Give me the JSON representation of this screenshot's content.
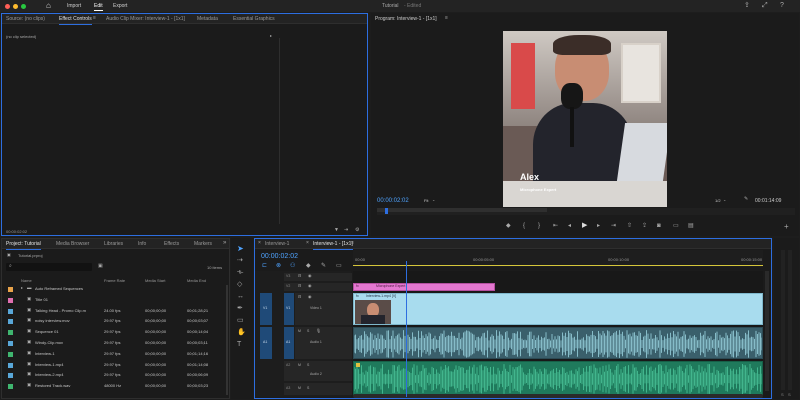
{
  "app": {
    "menu": [
      "Import",
      "Edit",
      "Export"
    ],
    "title": "Tutorial",
    "subtitle": "- Edited"
  },
  "effect_panel": {
    "tabs": [
      "Source: (no clips)",
      "Effect Controls",
      "Audio Clip Mixer: Interview-1 - [1x1]",
      "Metadata",
      "Essential Graphics"
    ],
    "active_tab": "Effect Controls",
    "no_clip": "(no clip selected)",
    "timecode": "00:00:02:02"
  },
  "program": {
    "title": "Program: Interview-1 - [1x1]",
    "caption_name": "Alex",
    "caption_sub": "Microphone Expert",
    "timecode": "00:00:02:02",
    "fit": "Fit",
    "fraction": "1/2",
    "duration": "00:01:14:09",
    "playhead_fraction": 0.02
  },
  "project": {
    "tabs": [
      "Project: Tutorial",
      "Media Browser",
      "Libraries",
      "Info",
      "Effects",
      "Markers"
    ],
    "file": "Tutorial.prproj",
    "items_count": "10 items",
    "columns": [
      "Name",
      "Frame Rate",
      "Media Start",
      "Media End"
    ],
    "rows": [
      {
        "name": "Auto Reframed Sequences",
        "fps": "",
        "start": "",
        "end": "",
        "color": "#e9a34a",
        "folder": true
      },
      {
        "name": "Title 01",
        "fps": "",
        "start": "",
        "end": "",
        "color": "#e06fb0",
        "folder": false
      },
      {
        "name": "Talking Head - Promo Clip.m",
        "fps": "24.00 fps",
        "start": "00;00;00;00",
        "end": "00;01;28;21",
        "color": "#59a7d8",
        "folder": false
      },
      {
        "name": "noisy interview.mov",
        "fps": "29.97 fps",
        "start": "00;00;00;00",
        "end": "00;00;03;07",
        "color": "#59a7d8",
        "folder": false
      },
      {
        "name": "Sequence 01",
        "fps": "29.97 fps",
        "start": "00;00;00;00",
        "end": "00;00;14;04",
        "color": "#3fb56f",
        "folder": false
      },
      {
        "name": "Windy-Clip.mov",
        "fps": "29.97 fps",
        "start": "00;00;00;00",
        "end": "00;00;03;11",
        "color": "#59a7d8",
        "folder": false
      },
      {
        "name": "Interview-1",
        "fps": "29.97 fps",
        "start": "00;00;00;00",
        "end": "00;01;14;16",
        "color": "#3fb56f",
        "folder": false
      },
      {
        "name": "Interview-1.mp4",
        "fps": "29.97 fps",
        "start": "00;00;00;00",
        "end": "00;01;14;08",
        "color": "#59a7d8",
        "folder": false
      },
      {
        "name": "Interview-2.mp4",
        "fps": "29.97 fps",
        "start": "00;00;00;00",
        "end": "00;00;06;09",
        "color": "#59a7d8",
        "folder": false
      },
      {
        "name": "Restored Track.wav",
        "fps": "48000 Hz",
        "start": "00;00;00;00",
        "end": "00;00;03;23",
        "color": "#3fb56f",
        "folder": false
      }
    ]
  },
  "timeline": {
    "tabs": [
      "Interview-1",
      "Interview-1 - [1x1]"
    ],
    "active_tab": "Interview-1 - [1x1]",
    "timecode": "00:00:02:02",
    "ruler": [
      "00:00",
      "00:00:05:00",
      "00:00:10:00",
      "00:00:15:00"
    ],
    "tracks": {
      "v3": "V3",
      "v2": "V2",
      "v1": "V1",
      "v1_name": "Video 1",
      "a1": "A1",
      "a1_name": "Audio 1",
      "a2": "A2",
      "a2_name": "Audio 2",
      "a3": "A3"
    },
    "clips": {
      "title_clip": "Microphone Expert",
      "video_clip": "Interview-1.mp4 [V]",
      "fx": "fx"
    }
  },
  "colors": {
    "accent": "#2d6ee0",
    "video_clip": "#a8dcee",
    "title_clip": "#e477d0",
    "audio_clip_1": "#86bcc8",
    "audio_clip_2": "#42b58d"
  }
}
